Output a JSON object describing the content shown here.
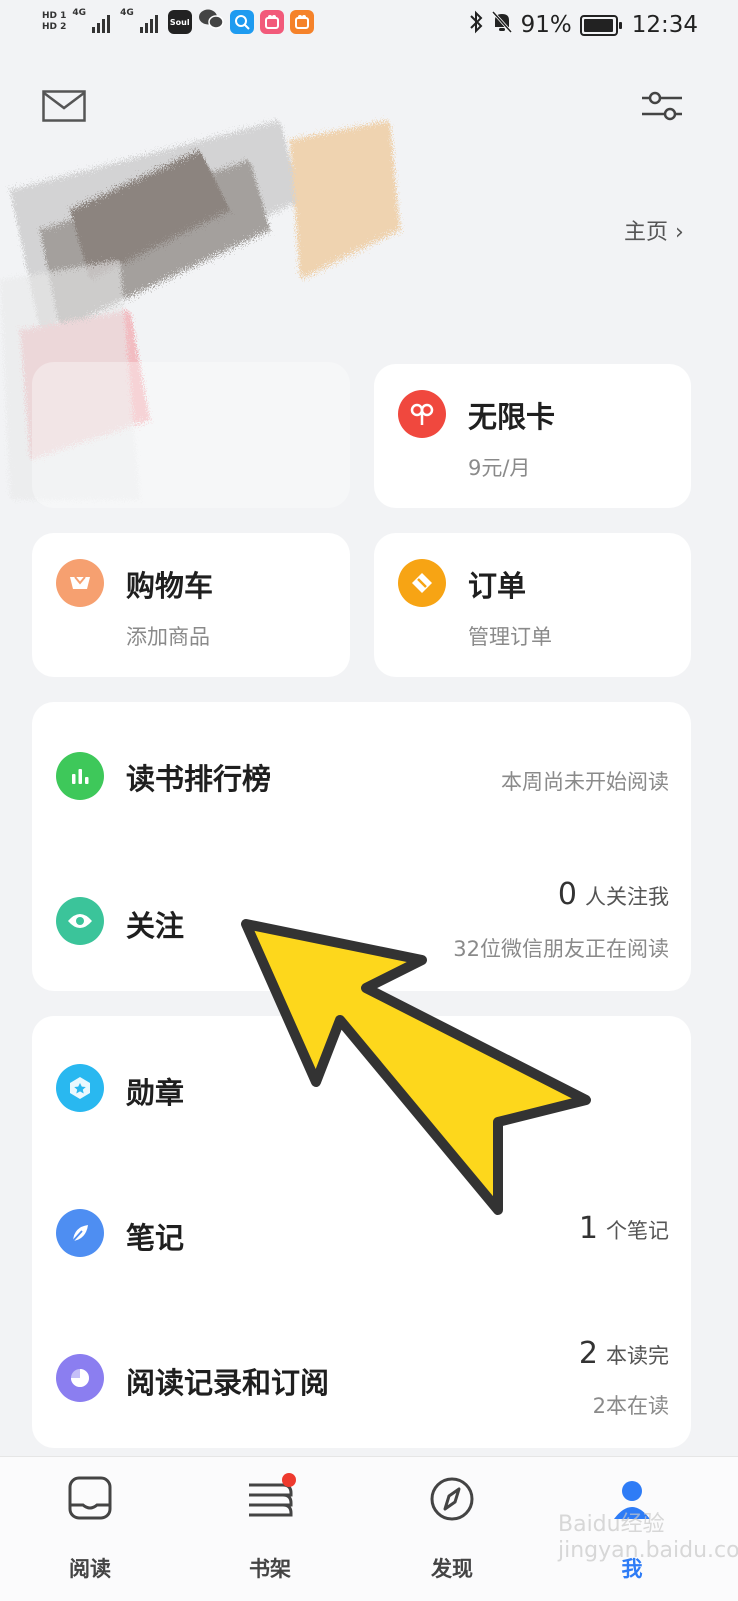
{
  "status_bar": {
    "hd1": "HD 1",
    "hd2": "HD 2",
    "net1": "4G",
    "net2": "4G",
    "soul": "Soul",
    "battery": "91%",
    "time": "12:34"
  },
  "header": {
    "homepage_link": "主页"
  },
  "cards": {
    "unlimited": {
      "title": "无限卡",
      "subtitle": "9元/月"
    },
    "cart": {
      "title": "购物车",
      "subtitle": "添加商品"
    },
    "orders": {
      "title": "订单",
      "subtitle": "管理订单"
    }
  },
  "social": {
    "ranking": {
      "title": "读书排行榜",
      "status": "本周尚未开始阅读"
    },
    "follow": {
      "title": "关注",
      "count": "0",
      "count_label": "人关注我",
      "friends_text": "32位微信朋友正在阅读"
    }
  },
  "records": {
    "badges": {
      "title": "勋章"
    },
    "notes": {
      "title": "笔记",
      "count": "1",
      "count_label": "个笔记"
    },
    "history": {
      "title": "阅读记录和订阅",
      "finished_count": "2",
      "finished_label": "本读完",
      "reading_text": "2本在读"
    }
  },
  "tabbar": {
    "read": "阅读",
    "shelf": "书架",
    "discover": "发现",
    "me": "我"
  },
  "watermark": "Baidu经验 jingyan.baidu.com",
  "colors": {
    "unlimited_icon": "#f0483e",
    "cart_icon": "#f6a070",
    "orders_icon": "#f7a414",
    "ranking_icon": "#3ec85a",
    "follow_icon": "#3bc49a",
    "badges_icon": "#29b8f0",
    "notes_icon": "#4e8ef2",
    "history_icon": "#8b7ef0",
    "active_tab": "#2e7cf6",
    "arrow_fill": "#fdd71c"
  }
}
